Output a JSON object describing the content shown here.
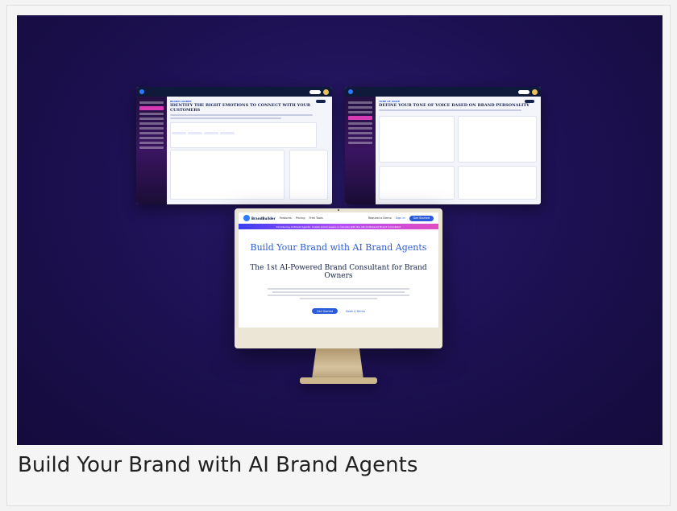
{
  "caption": "Build Your Brand with AI Brand Agents",
  "site": {
    "nav": {
      "logo_text": "BrandBuilder",
      "links": [
        "Features",
        "Pricing",
        "Free Tools"
      ],
      "request_demo": "Request a Demo",
      "sign_in": "Sign In",
      "cta": "Get Started"
    },
    "banner": "Introducing AI Brand Agents: Create brand assets in minutes with the 1st AI-Powered Brand Consultant",
    "headline_1": "Build Your Brand with AI Brand Agents",
    "headline_2": "The 1st AI-Powered Brand Consultant for Brand Owners",
    "primary_button": "Get Started",
    "secondary_button": "Book A Demo"
  },
  "windows": {
    "left_kicker": "BRAND LADDER",
    "left_title": "IDENTIFY THE RIGHT EMOTIONS TO CONNECT WITH YOUR CUSTOMERS",
    "right_kicker": "TONE OF VOICE",
    "right_title": "DEFINE YOUR TONE OF VOICE BASED ON BRAND PERSONALITY"
  },
  "colors": {
    "accent": "#2b5bd8",
    "navy": "#14224d",
    "background": "#1c1050",
    "gradient_pink": "#e04cc3"
  }
}
